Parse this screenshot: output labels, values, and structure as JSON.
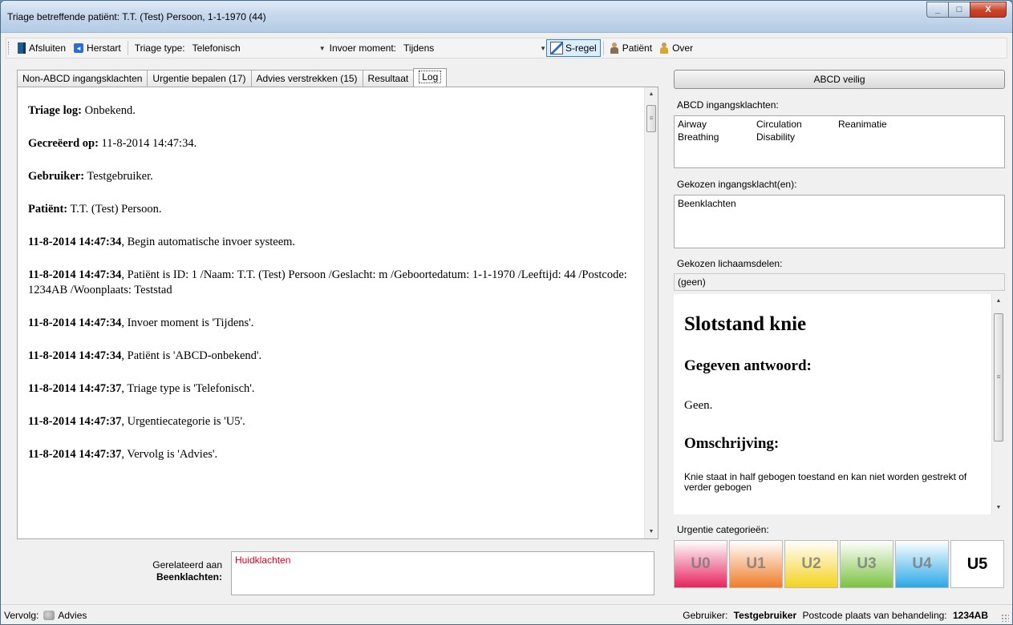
{
  "window": {
    "title": "Triage betreffende patiënt: T.T. (Test) Persoon, 1-1-1970 (44)",
    "controls": {
      "minimize": "_",
      "maximize": "□",
      "close": "X"
    }
  },
  "toolbar": {
    "exit_label": "Afsluiten",
    "restart_label": "Herstart",
    "triage_type_label": "Triage type:",
    "triage_type_value": "Telefonisch",
    "input_moment_label": "Invoer moment:",
    "input_moment_value": "Tijdens",
    "sregel_label": "S-regel",
    "patient_label": "Patiënt",
    "about_label": "Over"
  },
  "tabs": [
    {
      "label": "Non-ABCD ingangsklachten"
    },
    {
      "label": "Urgentie bepalen (17)"
    },
    {
      "label": "Advies verstrekken (15)"
    },
    {
      "label": "Resultaat"
    },
    {
      "label": "Log",
      "active": true
    }
  ],
  "log": [
    {
      "bold": "Triage log:",
      "text": " Onbekend."
    },
    {
      "bold": "Gecreëerd op:",
      "text": " 11-8-2014 14:47:34."
    },
    {
      "bold": "Gebruiker:",
      "text": " Testgebruiker."
    },
    {
      "bold": "Patiënt:",
      "text": " T.T. (Test) Persoon."
    },
    {
      "bold": "11-8-2014 14:47:34",
      "text": ", Begin automatische invoer systeem."
    },
    {
      "bold": "11-8-2014 14:47:34",
      "text": ", Patiënt is ID: 1 /Naam: T.T. (Test) Persoon /Geslacht: m /Geboortedatum: 1-1-1970 /Leeftijd: 44 /Postcode: 1234AB /Woonplaats: Teststad"
    },
    {
      "bold": "11-8-2014 14:47:34",
      "text": ", Invoer moment is 'Tijdens'."
    },
    {
      "bold": "11-8-2014 14:47:34",
      "text": ", Patiënt is 'ABCD-onbekend'."
    },
    {
      "bold": "11-8-2014 14:47:37",
      "text": ", Triage type is 'Telefonisch'."
    },
    {
      "bold": "11-8-2014 14:47:37",
      "text": ", Urgentiecategorie is 'U5'."
    },
    {
      "bold": "11-8-2014 14:47:37",
      "text": ", Vervolg is 'Advies'."
    }
  ],
  "related": {
    "label_line1": "Gerelateerd aan",
    "label_line2": "Beenklachten:",
    "value": "Huidklachten"
  },
  "right": {
    "abcd_button": "ABCD veilig",
    "abcd_label": "ABCD ingangsklachten:",
    "abcd_items": [
      "Airway",
      "Circulation",
      "Reanimatie",
      "Breathing",
      "Disability"
    ],
    "chosen_label": "Gekozen ingangsklacht(en):",
    "chosen_value": "Beenklachten",
    "body_parts_label": "Gekozen lichaamsdelen:",
    "body_parts_value": "(geen)",
    "answer_title": "Slotstand knie",
    "answer_heading": "Gegeven antwoord:",
    "answer_value": "Geen.",
    "description_heading": "Omschrijving:",
    "description_text": "Knie staat in half gebogen toestand en kan niet worden gestrekt of verder gebogen",
    "urgency_label": "Urgentie categorieën:",
    "urgency": [
      {
        "label": "U0",
        "color": "#e6245e"
      },
      {
        "label": "U1",
        "color": "#f07c2a"
      },
      {
        "label": "U2",
        "color": "#f4d21e"
      },
      {
        "label": "U3",
        "color": "#7dc242"
      },
      {
        "label": "U4",
        "color": "#2aa8e6"
      },
      {
        "label": "U5",
        "color": "#ffffff",
        "active": true
      }
    ]
  },
  "status": {
    "followup_label": "Vervolg:",
    "followup_value": "Advies",
    "user_label": "Gebruiker:",
    "user_value": "Testgebruiker",
    "postcode_label": "Postcode plaats van behandeling:",
    "postcode_value": "1234AB"
  }
}
